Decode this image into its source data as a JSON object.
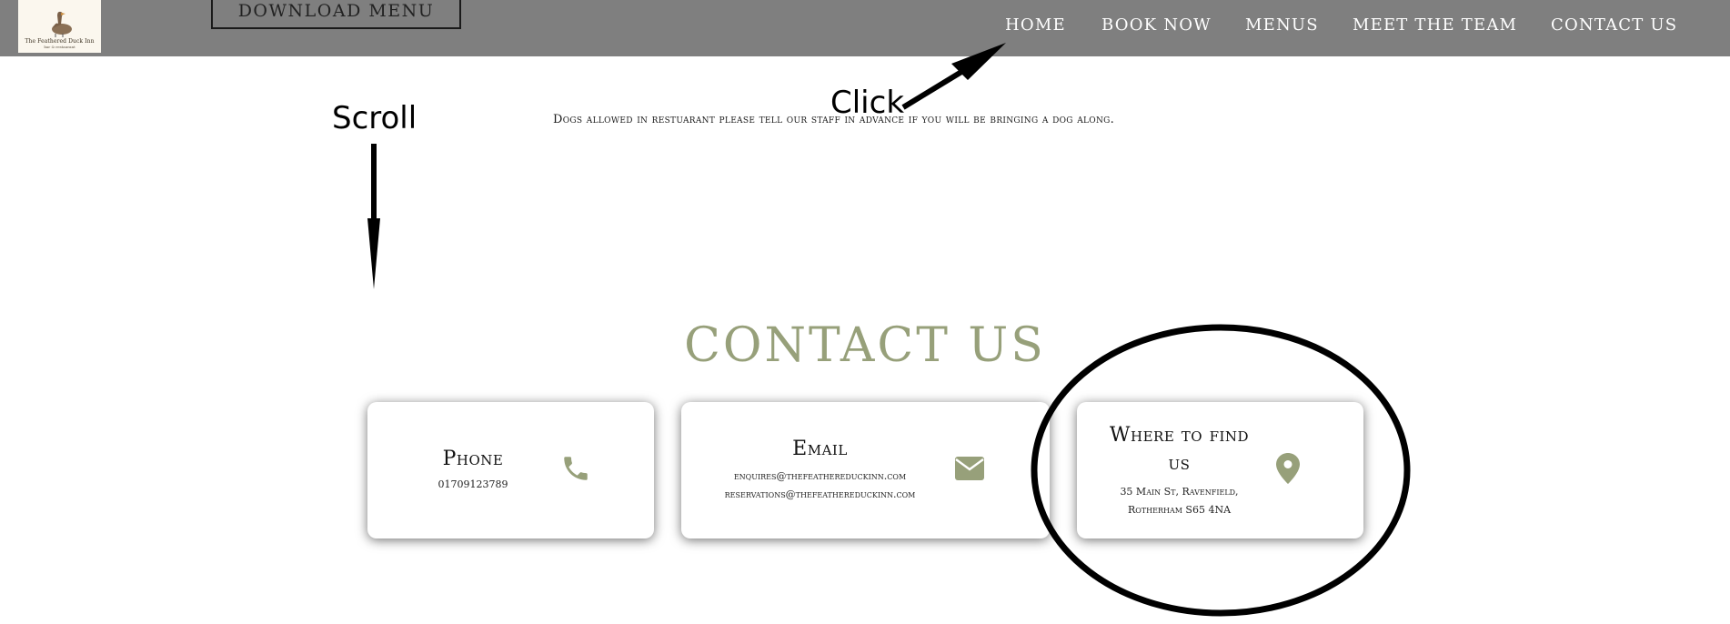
{
  "header": {
    "logo": {
      "title": "The Feathered Duck Inn",
      "subtitle": "bar & restaurant"
    },
    "download_label": "DOWNLOAD MENU",
    "nav": [
      "HOME",
      "BOOK NOW",
      "MENUS",
      "MEET THE TEAM",
      "CONTACT US"
    ]
  },
  "notice": "Dogs allowed in restuarant please tell our staff in advance if you will be bringing a dog along.",
  "contact": {
    "title": "CONTACT US",
    "phone": {
      "heading": "Phone",
      "value": "01709123789",
      "icon": "phone-icon"
    },
    "email": {
      "heading": "Email",
      "lines": [
        "enquires@thefeathereduckinn.com",
        "reservations@thefeathereduckinn.com"
      ],
      "icon": "envelope-icon"
    },
    "location": {
      "heading_line1": "Where to find",
      "heading_line2": "us",
      "address_line1": "35 Main St, Ravenfield,",
      "address_line2": "Rotherham S65 4NA",
      "icon": "map-pin-icon"
    }
  },
  "annotations": {
    "scroll": "Scroll",
    "click": "Click"
  },
  "colors": {
    "header_bg": "#7f7f7f",
    "accent": "#97a07a",
    "logo_bg": "#fbf7ee"
  }
}
